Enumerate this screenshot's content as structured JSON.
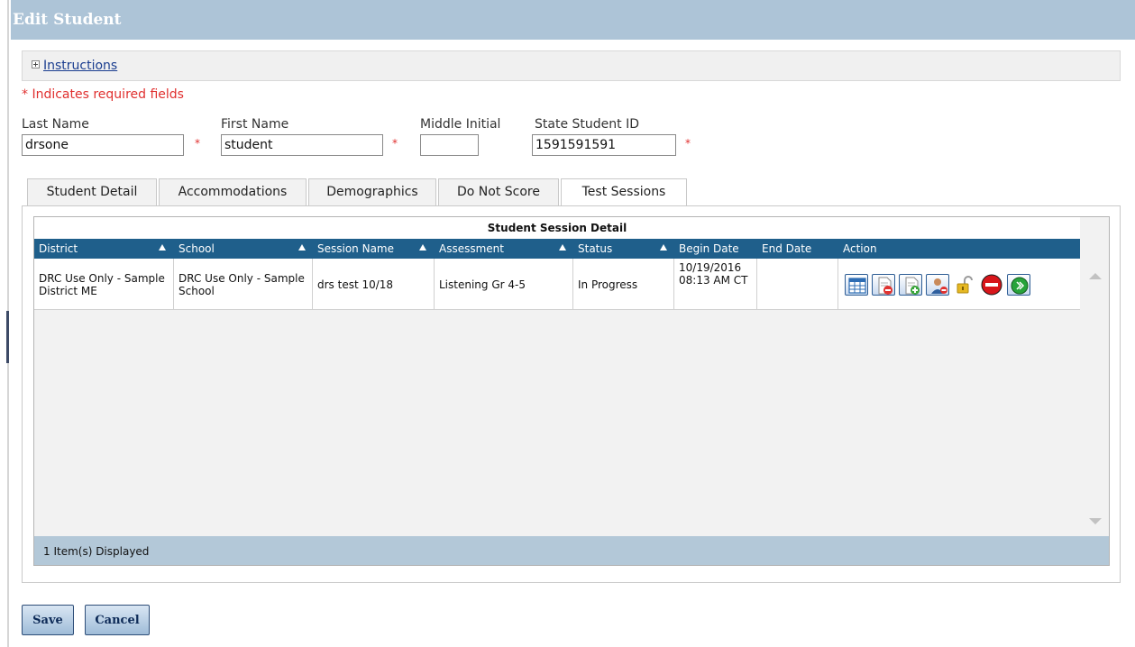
{
  "window": {
    "title": "Edit Student"
  },
  "instructions": {
    "label": "Instructions"
  },
  "required_note": "* Indicates required fields",
  "fields": {
    "last_name": {
      "label": "Last Name",
      "value": "drsone"
    },
    "first_name": {
      "label": "First Name",
      "value": "student"
    },
    "middle_initial": {
      "label": "Middle Initial",
      "value": ""
    },
    "state_student_id": {
      "label": "State Student ID",
      "value": "1591591591"
    },
    "required_marker": "*"
  },
  "tabs": [
    {
      "label": "Student Detail",
      "active": false
    },
    {
      "label": "Accommodations",
      "active": false
    },
    {
      "label": "Demographics",
      "active": false
    },
    {
      "label": "Do Not Score",
      "active": false
    },
    {
      "label": "Test Sessions",
      "active": true
    }
  ],
  "grid": {
    "caption": "Student Session Detail",
    "columns": [
      "District",
      "School",
      "Session Name",
      "Assessment",
      "Status",
      "Begin Date",
      "End Date",
      "Action"
    ],
    "rows": [
      {
        "district": "DRC Use Only - Sample District ME",
        "school": "DRC Use Only - Sample School",
        "session_name": "drs test 10/18",
        "assessment": "Listening Gr 4-5",
        "status": "In Progress",
        "begin_date": "10/19/2016 08:13 AM CT",
        "end_date": "",
        "actions": [
          "view-details-icon",
          "remove-document-icon",
          "add-document-icon",
          "remove-student-icon",
          "unlock-icon",
          "stop-icon",
          "resume-icon"
        ]
      }
    ],
    "footer": "1 Item(s) Displayed"
  },
  "buttons": {
    "save": "Save",
    "cancel": "Cancel"
  },
  "colors": {
    "title_bar": "#adc4d7",
    "grid_header": "#1f5f8b",
    "grid_footer": "#b3c8d8",
    "required": "#e0302f",
    "link": "#1a3d8f"
  }
}
